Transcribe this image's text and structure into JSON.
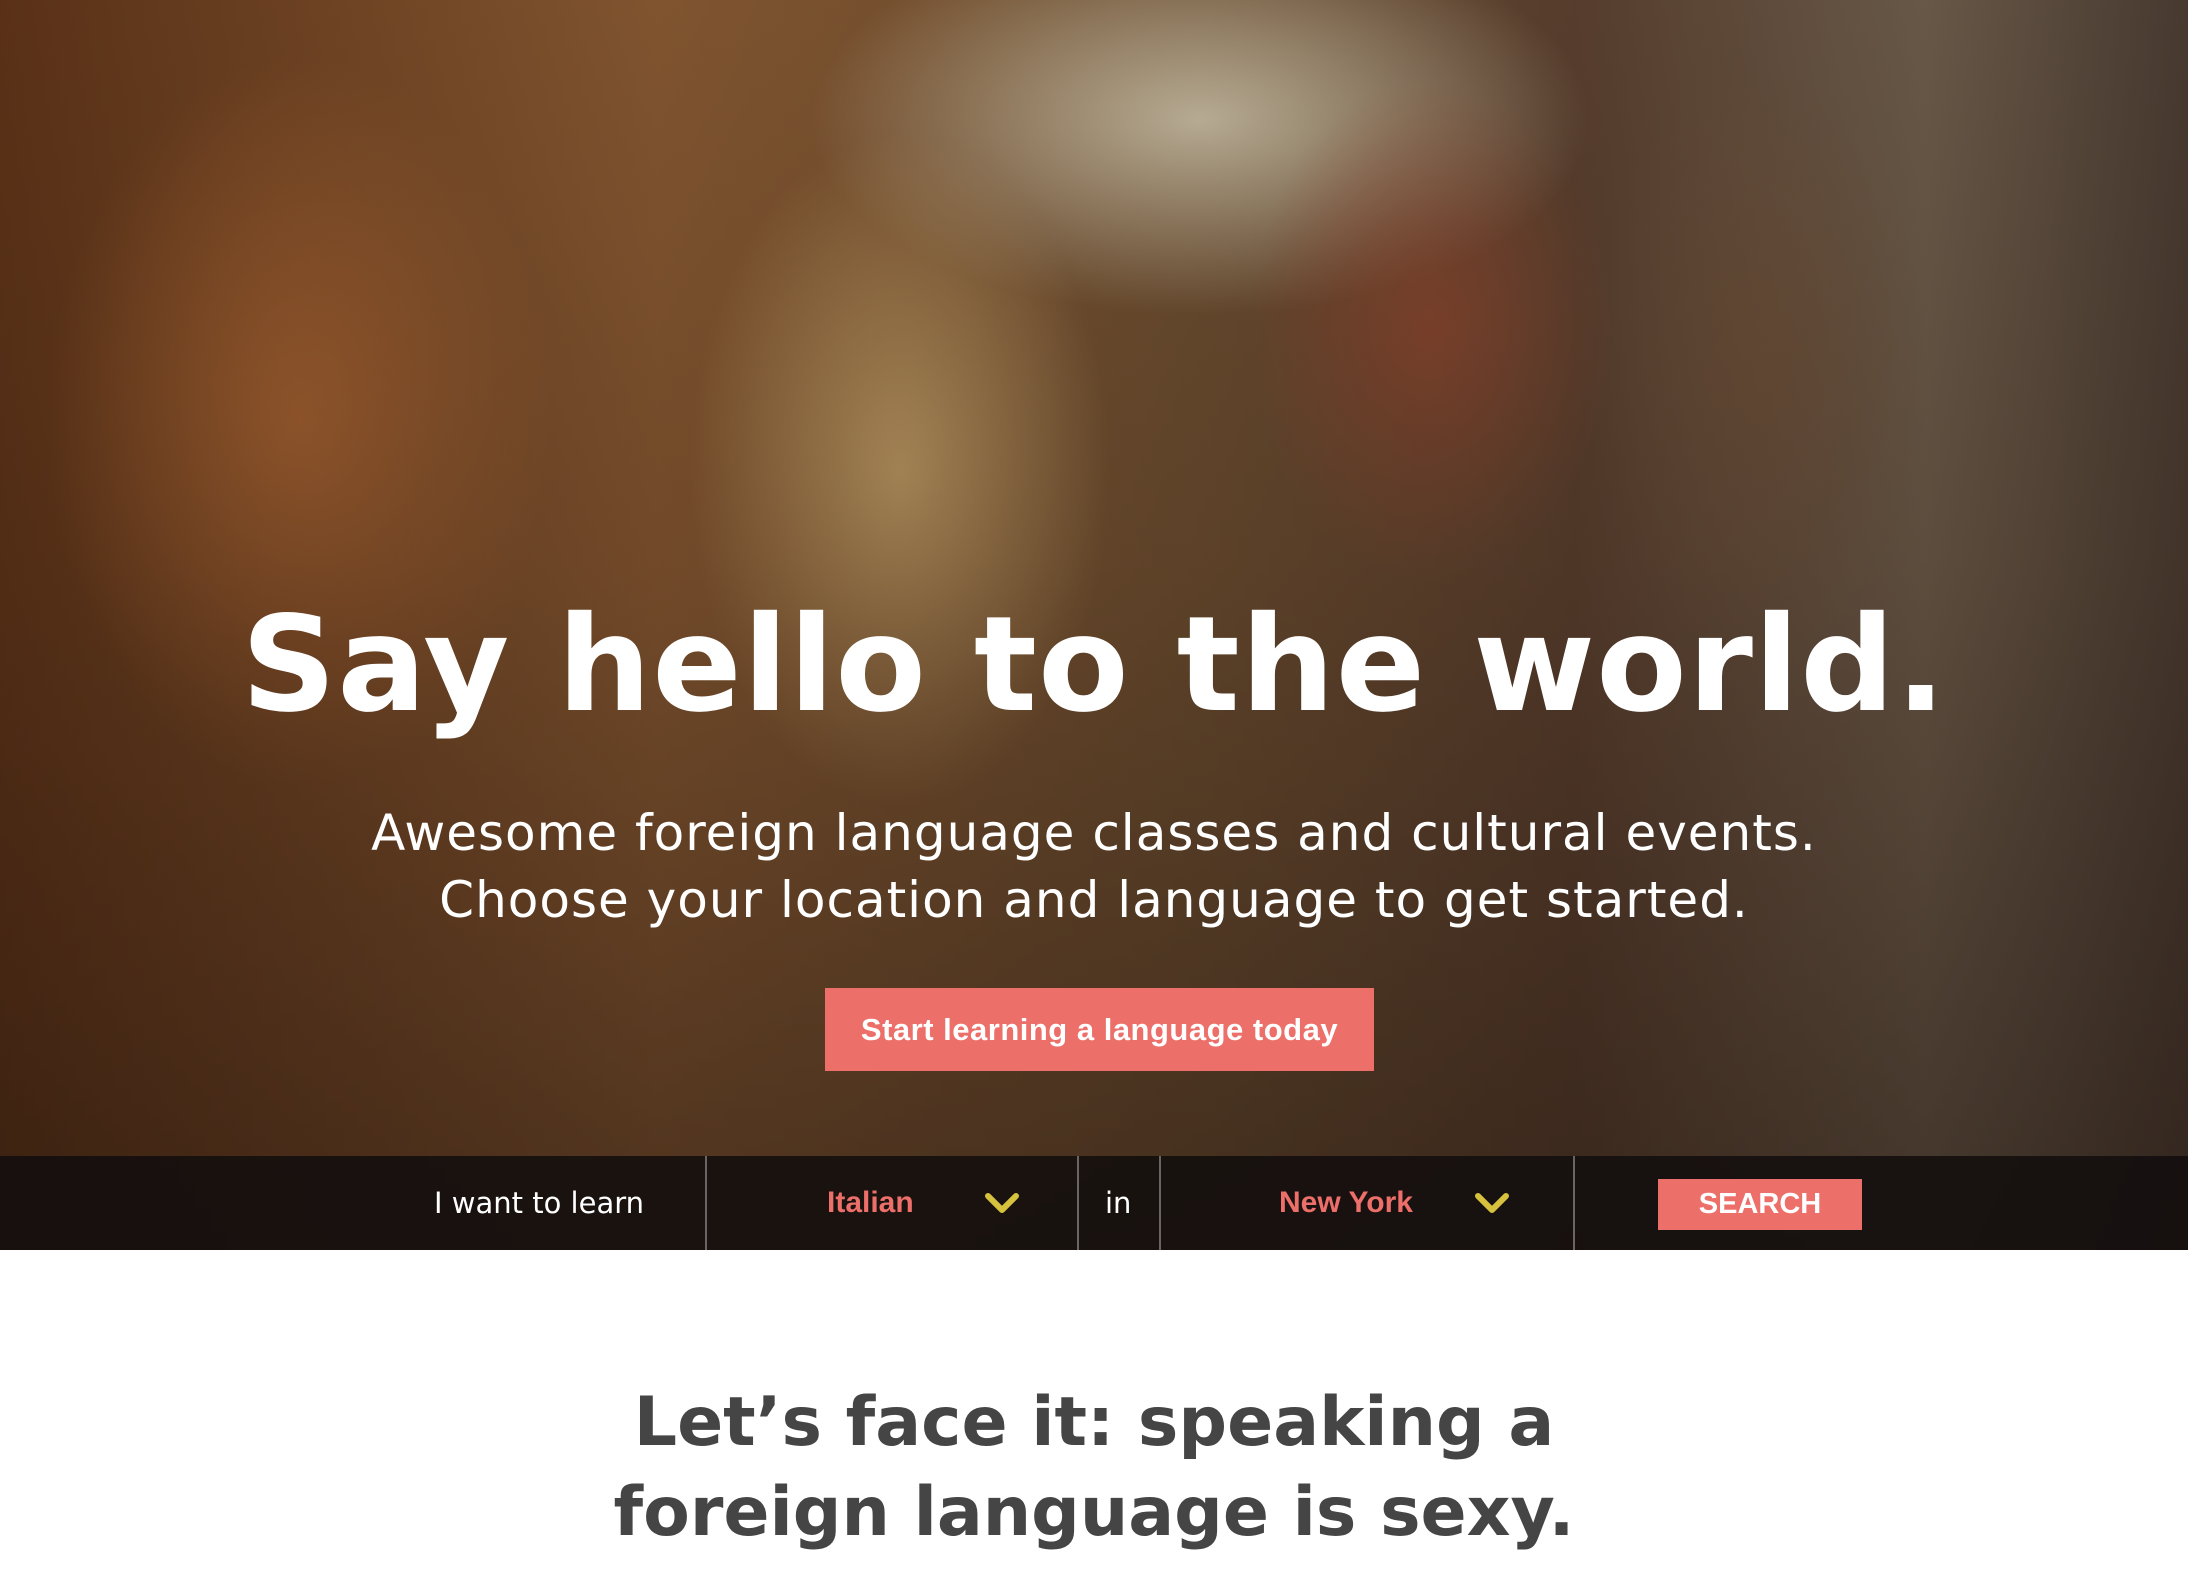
{
  "hero": {
    "title": "Say hello to the world.",
    "subtitle_line1": "Awesome foreign language classes and cultural events.",
    "subtitle_line2": "Choose your location and language to get started.",
    "cta_label": "Start learning a language today"
  },
  "search": {
    "prefix_label": "I want to learn",
    "language_value": "Italian",
    "connector_label": "in",
    "location_value": "New York",
    "button_label": "SEARCH",
    "chevron_icon": "chevron-down-icon"
  },
  "section": {
    "title_line1": "Let’s face it: speaking a",
    "title_line2": "foreign language is sexy."
  },
  "colors": {
    "accent": "#ec6f6a",
    "chevron": "#d6c23c",
    "search_bar_bg": "#120e0e",
    "section_title": "#454545"
  }
}
